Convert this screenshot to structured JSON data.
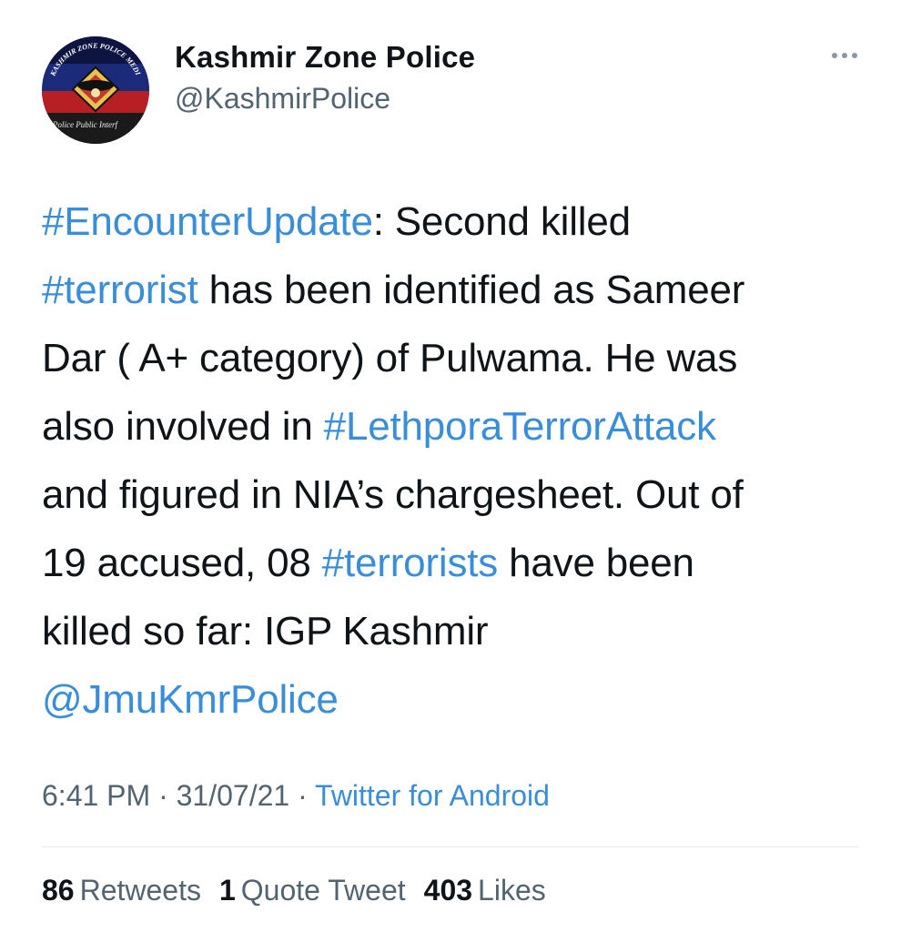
{
  "author": {
    "name": "Kashmir Zone Police",
    "handle": "@KashmirPolice",
    "avatar_text_top": "KASHMIR ZONE POLICE MEDIA CENTRE",
    "avatar_text_bottom": "Police Public Interface"
  },
  "tweet": {
    "lines": [
      [
        {
          "t": "#EncounterUpdate",
          "link": true
        },
        {
          "t": ": Second killed",
          "link": false
        }
      ],
      [
        {
          "t": "#terrorist",
          "link": true
        },
        {
          "t": " has been identified as Sameer",
          "link": false
        }
      ],
      [
        {
          "t": "Dar ( A+ category) of Pulwama. He was",
          "link": false
        }
      ],
      [
        {
          "t": "also involved in ",
          "link": false
        },
        {
          "t": "#LethporaTerrorAttack",
          "link": true
        }
      ],
      [
        {
          "t": "and figured in NIA’s chargesheet. Out of",
          "link": false
        }
      ],
      [
        {
          "t": "19 accused, 08 ",
          "link": false
        },
        {
          "t": "#terrorists",
          "link": true
        },
        {
          "t": " have been",
          "link": false
        }
      ],
      [
        {
          "t": "killed so far: IGP Kashmir",
          "link": false
        }
      ],
      [
        {
          "t": "@JmuKmrPolice",
          "link": true
        }
      ]
    ]
  },
  "meta": {
    "time": "6:41 PM",
    "separator": " · ",
    "date": "31/07/21",
    "source": "Twitter for Android"
  },
  "stats": {
    "retweets_count": "86",
    "retweets_label": "Retweets",
    "quotes_count": "1",
    "quotes_label": "Quote Tweet",
    "likes_count": "403",
    "likes_label": "Likes"
  },
  "colors": {
    "link": "#3a8dd8",
    "secondary": "#536471",
    "primary": "#0f1419"
  },
  "icons": {
    "more": "more-options-icon"
  }
}
